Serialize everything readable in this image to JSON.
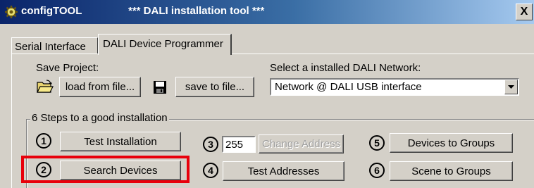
{
  "window": {
    "app_name": "configTOOL",
    "subtitle": "*** DALI installation tool ***",
    "close_label": "X"
  },
  "tabs": [
    {
      "label": "Serial Interface",
      "active": false
    },
    {
      "label": "DALI Device Programmer",
      "active": true
    }
  ],
  "project": {
    "save_label": "Save Project:",
    "load_button": "load from file...",
    "save_button": "save to file..."
  },
  "network": {
    "label": "Select a installed DALI Network:",
    "selected": "Network @ DALI USB interface"
  },
  "steps": {
    "group_title": "6 Steps to a good installation",
    "step1": {
      "number": "1",
      "label": "Test Installation"
    },
    "step2": {
      "number": "2",
      "label": "Search Devices"
    },
    "step3": {
      "number": "3",
      "address_value": "255",
      "label": "Change Address"
    },
    "step4": {
      "number": "4",
      "label": "Test Addresses"
    },
    "step5": {
      "number": "5",
      "label": "Devices to Groups"
    },
    "step6": {
      "number": "6",
      "label": "Scene to Groups"
    }
  },
  "colors": {
    "highlight": "#e8000b",
    "titlebar_start": "#0a246a",
    "titlebar_end": "#a6caf0"
  },
  "icons": {
    "app": "gear-icon",
    "load": "open-folder-icon",
    "save": "floppy-disk-icon",
    "dropdown": "chevron-down-icon"
  }
}
